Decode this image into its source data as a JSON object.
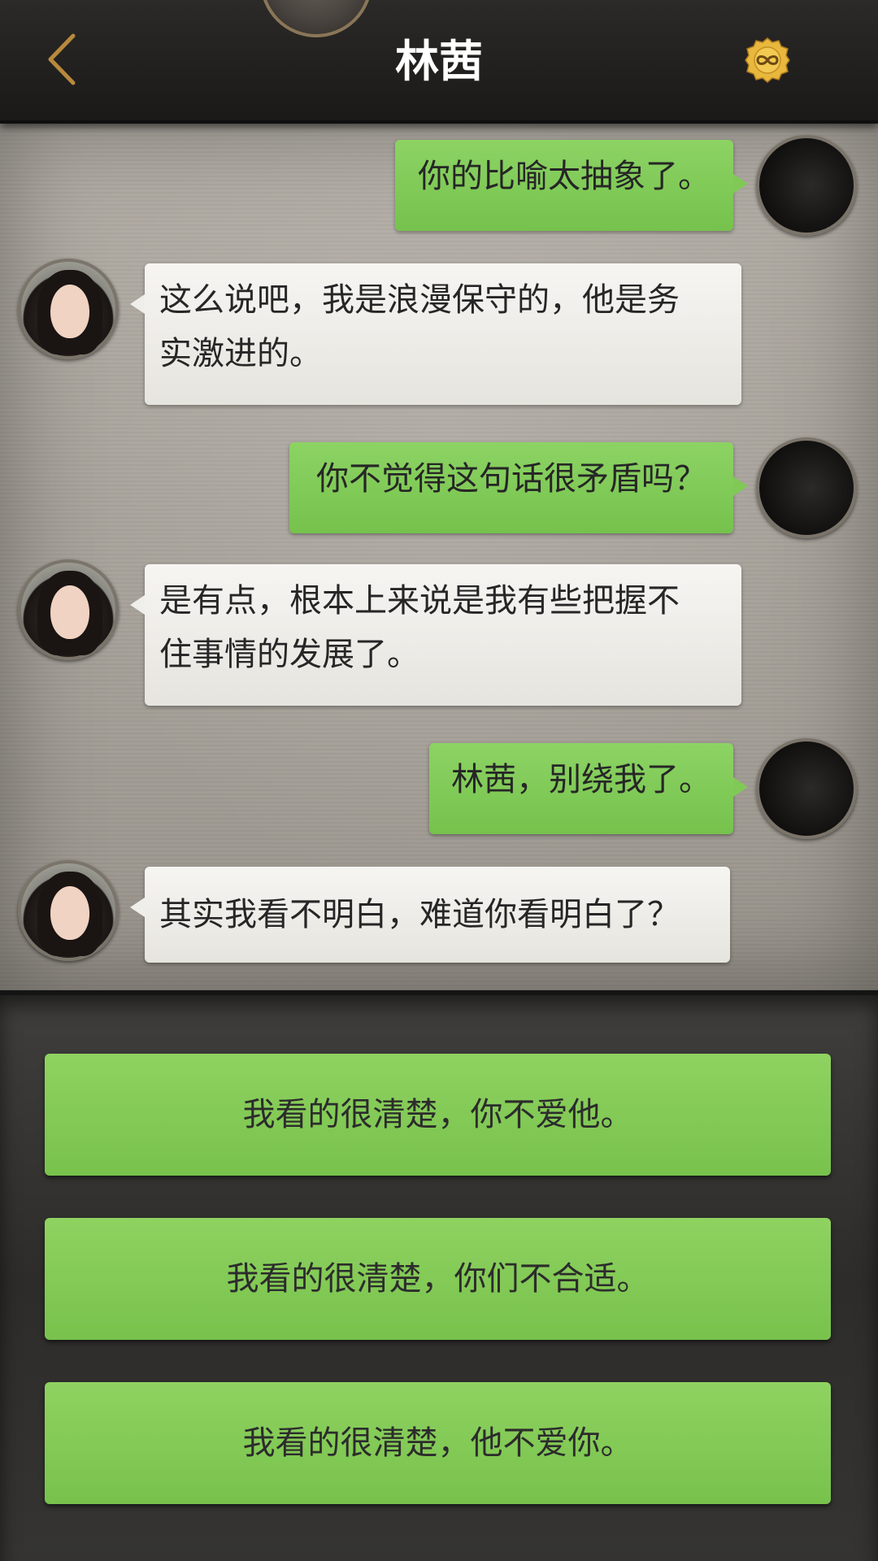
{
  "header": {
    "title": "林茜",
    "back_icon": "chevron-left-icon",
    "badge_icon": "infinity-coin-icon"
  },
  "messages": [
    {
      "sender": "player",
      "text": "你的比喻太抽象了。"
    },
    {
      "sender": "npc",
      "lines": [
        "这么说吧，我是浪漫保守的，他是务",
        "实激进的。"
      ]
    },
    {
      "sender": "player",
      "text": "你不觉得这句话很矛盾吗？"
    },
    {
      "sender": "npc",
      "lines": [
        "是有点，根本上来说是我有些把握不",
        "住事情的发展了。"
      ]
    },
    {
      "sender": "player",
      "text": "林茜，别绕我了。"
    },
    {
      "sender": "npc",
      "text": "其实我看不明白，难道你看明白了？"
    }
  ],
  "choices": [
    "我看的很清楚，你不爱他。",
    "我看的很清楚，你们不合适。",
    "我看的很清楚，他不爱你。"
  ],
  "colors": {
    "player_bubble": "#80c957",
    "npc_bubble": "#efeeea",
    "choice_button": "#84ca56",
    "header_bg": "#1f1e1c",
    "accent_gold": "#b8893c"
  }
}
